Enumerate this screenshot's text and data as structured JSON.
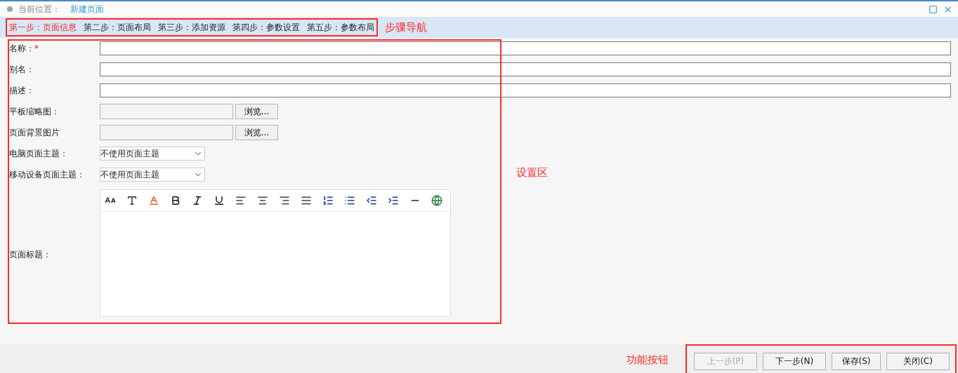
{
  "breadcrumb": {
    "label": "当前位置：",
    "current": "新建页面"
  },
  "steps": [
    {
      "label": "第一步：页面信息",
      "selected": true
    },
    {
      "label": "第二步：页面布局",
      "selected": false
    },
    {
      "label": "第三步：添加资源",
      "selected": false
    },
    {
      "label": "第四步：参数设置",
      "selected": false
    },
    {
      "label": "第五步：参数布局",
      "selected": false
    }
  ],
  "annotations": {
    "steps": "步骤导航",
    "settings": "设置区",
    "buttons": "功能按钮"
  },
  "form": {
    "fields": [
      {
        "kind": "text",
        "label": "名称：",
        "required_mark": "*"
      },
      {
        "kind": "text",
        "label": "别名："
      },
      {
        "kind": "text",
        "label": "描述："
      },
      {
        "kind": "file",
        "label": "平板缩略图：",
        "button": "浏览..."
      },
      {
        "kind": "file",
        "label": "页面背景图片",
        "button": "浏览..."
      },
      {
        "kind": "select",
        "label": "电脑页面主题：",
        "value": "不使用页面主题"
      },
      {
        "kind": "select",
        "label": "移动设备页面主题：",
        "value": "不使用页面主题"
      },
      {
        "kind": "editor",
        "label": "页面标题："
      }
    ]
  },
  "buttons": [
    {
      "label": "上一步(P)",
      "disabled": true
    },
    {
      "label": "下一步(N)",
      "disabled": false
    },
    {
      "label": "保存(S)",
      "disabled": false
    },
    {
      "label": "关闭(C)",
      "disabled": false
    }
  ]
}
